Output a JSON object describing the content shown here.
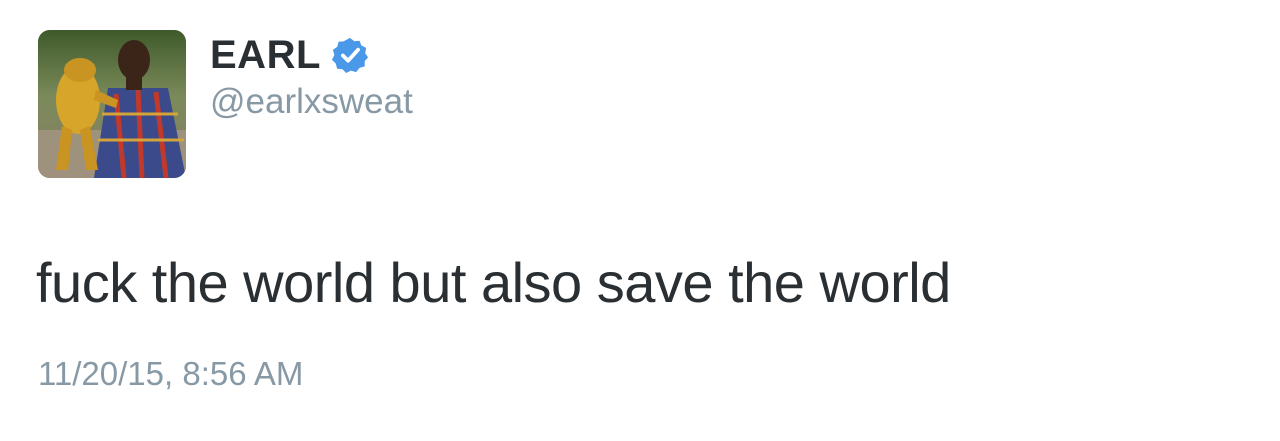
{
  "tweet": {
    "author": {
      "display_name": "EARL",
      "handle": "@earlxsweat",
      "verified": true,
      "verified_icon": "verified-badge-icon",
      "verified_color": "#4a99e9",
      "avatar": "profile-photo"
    },
    "text": "fuck the world but also save the world",
    "timestamp": "11/20/15, 8:56 AM"
  },
  "colors": {
    "text_primary": "#292f33",
    "text_secondary": "#8899a6",
    "background": "#ffffff"
  }
}
